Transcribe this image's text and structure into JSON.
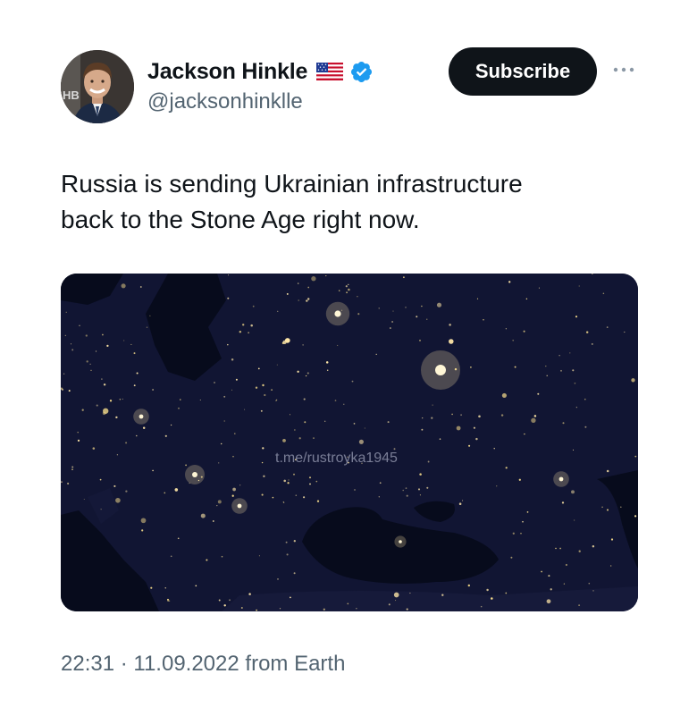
{
  "author": {
    "name": "Jackson Hinkle",
    "handle": "@jacksonhinklle",
    "flag_icon": "us-flag-emoji",
    "verified_icon": "verified-badge-icon",
    "verified_color": "#1d9bf0",
    "avatar_icon": "profile-photo"
  },
  "actions": {
    "subscribe_label": "Subscribe",
    "more_icon": "more-horizontal-icon"
  },
  "tweet": {
    "text_lines": [
      "Russia is sending Ukrainian infrastructure",
      "back to the Stone Age right now."
    ],
    "media": {
      "description_icon": "night-satellite-map",
      "watermark": "t.me/rustroyka1945"
    },
    "time": "22:31",
    "separator": " · ",
    "date": "11.09.2022",
    "source": " from Earth"
  },
  "colors": {
    "text_primary": "#0f1419",
    "text_secondary": "#536471",
    "button_bg": "#0f1419"
  }
}
